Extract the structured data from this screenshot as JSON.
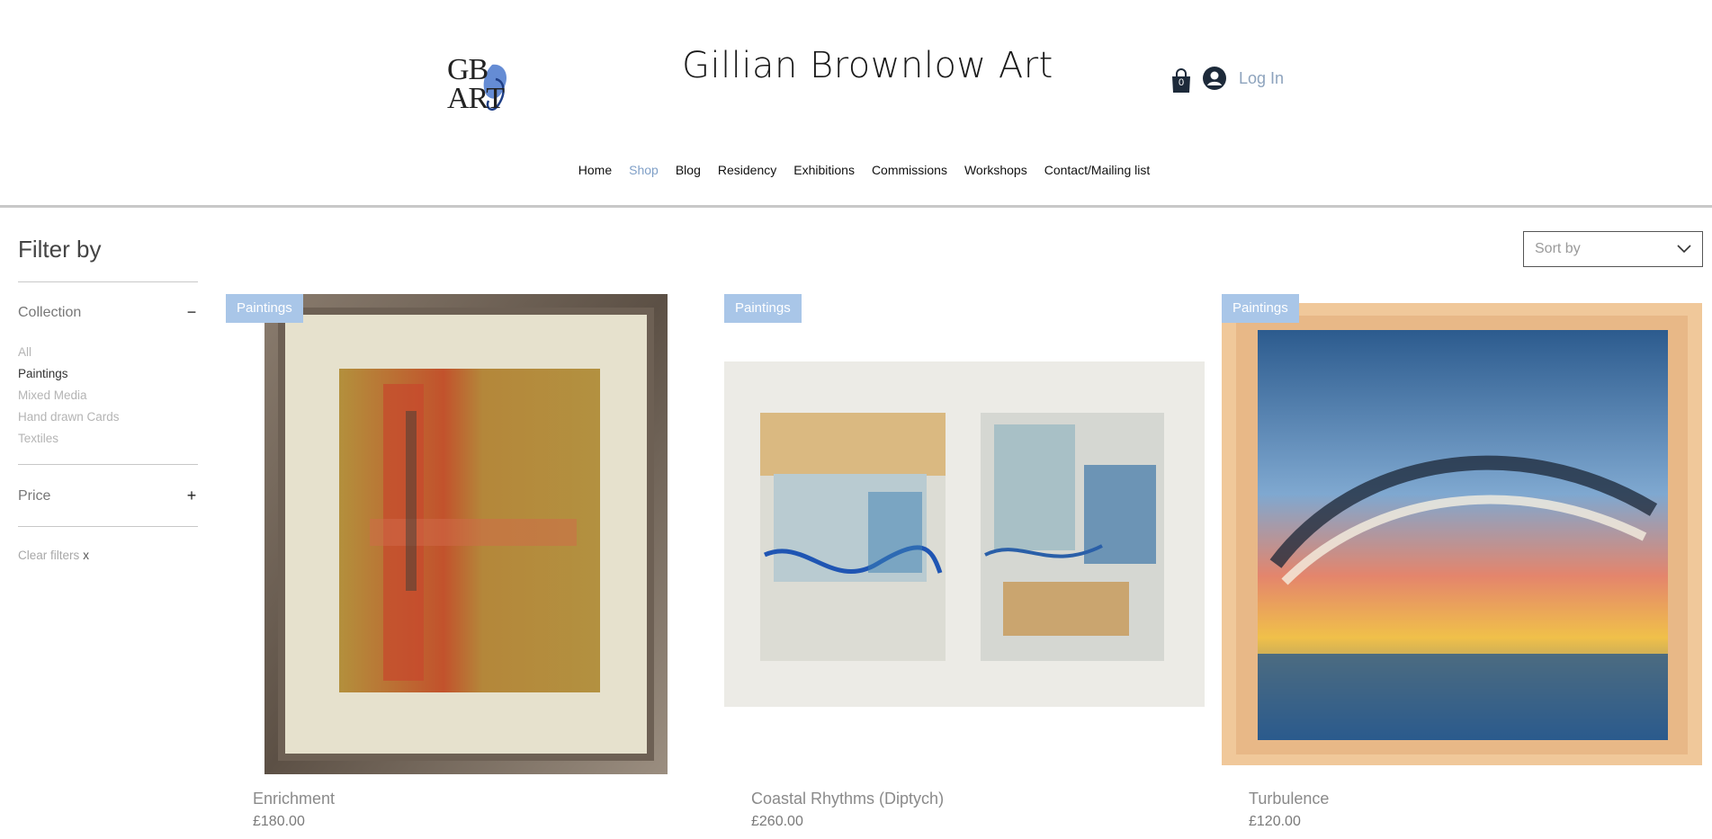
{
  "header": {
    "logo_text": "GB ART",
    "site_title": "Gillian Brownlow Art",
    "cart_count": "0",
    "login_label": "Log In"
  },
  "nav": {
    "items": [
      "Home",
      "Shop",
      "Blog",
      "Residency",
      "Exhibitions",
      "Commissions",
      "Workshops",
      "Contact/Mailing list"
    ],
    "active": "Shop"
  },
  "filters": {
    "title": "Filter by",
    "collection": {
      "label": "Collection",
      "toggle": "−",
      "items": [
        "All",
        "Paintings",
        "Mixed Media",
        "Hand drawn Cards",
        "Textiles"
      ],
      "selected": "Paintings"
    },
    "price": {
      "label": "Price",
      "toggle": "+"
    },
    "clear_label": "Clear filters",
    "clear_icon": "x"
  },
  "sort": {
    "label": "Sort by"
  },
  "products": [
    {
      "badge": "Paintings",
      "name": "Enrichment",
      "price": "£180.00"
    },
    {
      "badge": "Paintings",
      "name": "Coastal Rhythms (Diptych)",
      "price": "£260.00"
    },
    {
      "badge": "Paintings",
      "name": "Turbulence",
      "price": "£120.00"
    }
  ],
  "colors": {
    "accent": "#7f9fc7",
    "badge": "#a9c6e8",
    "cart": "#1d2a3a"
  },
  "icons": {
    "cart": "shopping-bag-icon",
    "avatar": "user-avatar-icon",
    "sort": "chevron-down-icon"
  }
}
